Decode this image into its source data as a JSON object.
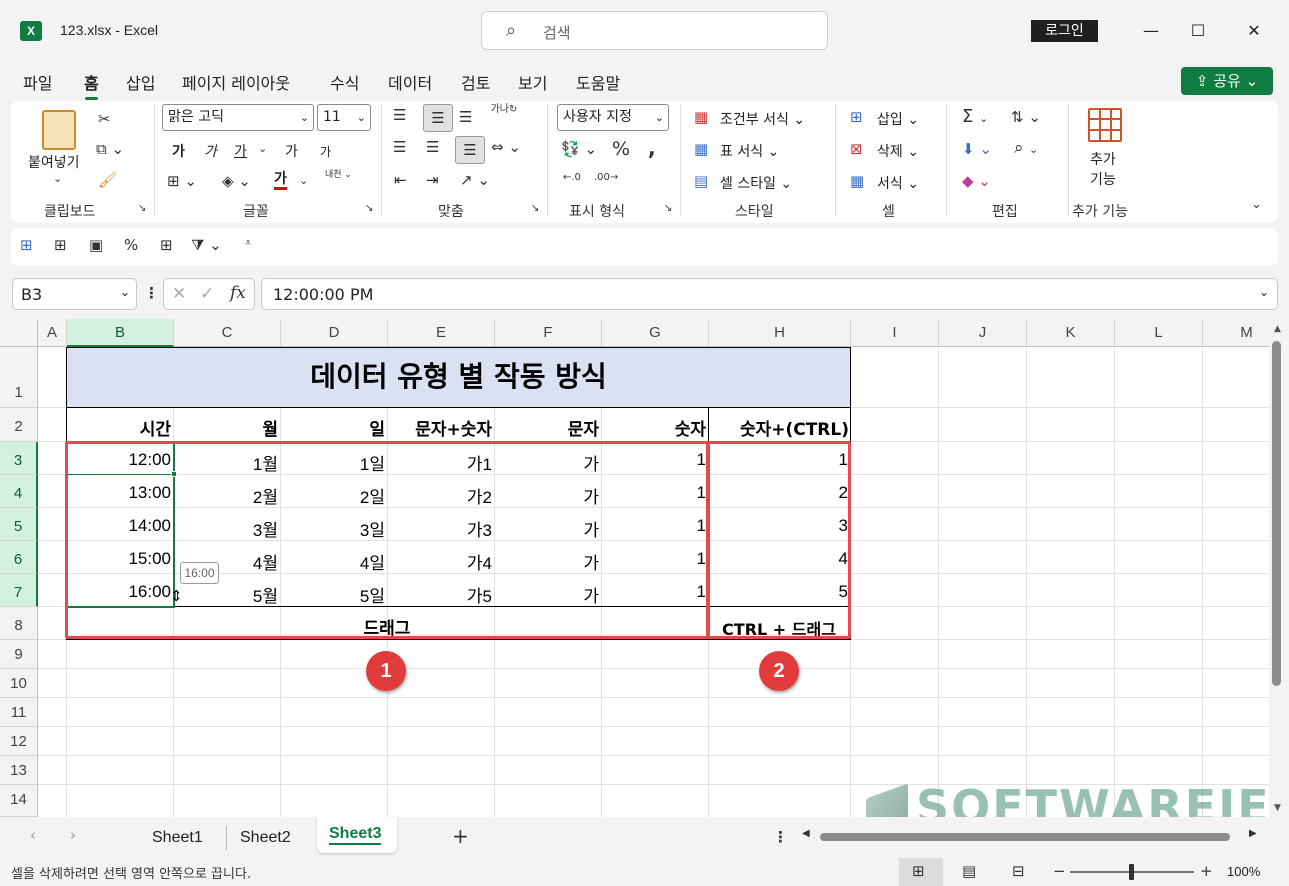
{
  "window": {
    "title": "123.xlsx  -  Excel",
    "logo": "X",
    "login": "로그인",
    "minimize": "—",
    "maximize": "☐",
    "close": "✕"
  },
  "search": {
    "placeholder": "검색"
  },
  "menu_tabs": [
    "파일",
    "홈",
    "삽입",
    "페이지 레이아웃",
    "수식",
    "데이터",
    "검토",
    "보기",
    "도움말"
  ],
  "share": {
    "label": "공유"
  },
  "ribbon": {
    "clipboard": {
      "paste": "붙여넣기",
      "label": "클립보드"
    },
    "font": {
      "name": "맑은 고딕",
      "size": "11",
      "bold": "가",
      "italic": "가",
      "underline": "가",
      "grow": "가",
      "shrink": "가",
      "color": "가",
      "label": "글꼴"
    },
    "align": {
      "label": "맞춤",
      "orient": "가나",
      "wrap": "내천"
    },
    "number": {
      "format": "사용자 지정",
      "label": "표시 형식"
    },
    "styles": {
      "conditional": "조건부 서식",
      "table": "표 서식",
      "cell": "셀 스타일",
      "label": "스타일"
    },
    "cells": {
      "insert": "삽입",
      "delete": "삭제",
      "format": "서식",
      "label": "셀"
    },
    "editing": {
      "label": "편집"
    },
    "addins": {
      "name": "추가 기능",
      "line1": "추가",
      "line2": "기능",
      "label": "추가 기능"
    }
  },
  "formula_bar": {
    "name_box": "B3",
    "value": "12:00:00 PM",
    "fx": "fx"
  },
  "columns": [
    "A",
    "B",
    "C",
    "D",
    "E",
    "F",
    "G",
    "H",
    "I",
    "J",
    "K",
    "L",
    "M"
  ],
  "rows": [
    "1",
    "2",
    "3",
    "4",
    "5",
    "6",
    "7",
    "8",
    "9",
    "10",
    "11",
    "12",
    "13",
    "14"
  ],
  "sheet": {
    "title": "데이터 유형 별 작동 방식",
    "headers": [
      "시간",
      "월",
      "일",
      "문자+숫자",
      "문자",
      "숫자",
      "숫자+(CTRL)"
    ],
    "data": [
      [
        "12:00",
        "1월",
        "1일",
        "가1",
        "가",
        "1",
        "1"
      ],
      [
        "13:00",
        "2월",
        "2일",
        "가2",
        "가",
        "1",
        "2"
      ],
      [
        "14:00",
        "3월",
        "3일",
        "가3",
        "가",
        "1",
        "3"
      ],
      [
        "15:00",
        "4월",
        "4일",
        "가4",
        "가",
        "1",
        "4"
      ],
      [
        "16:00",
        "5월",
        "5일",
        "가5",
        "가",
        "1",
        "5"
      ]
    ],
    "drag_label": "드래그",
    "ctrl_drag_label": "CTRL + 드래그",
    "tooltip": "16:00",
    "badge1": "1",
    "badge2": "2"
  },
  "sheet_tabs": [
    "Sheet1",
    "Sheet2",
    "Sheet3"
  ],
  "active_sheet": "Sheet3",
  "status": {
    "message": "셀을 삭제하려면 선택 영역 안쪽으로 끕니다.",
    "zoom": "100%"
  },
  "watermark": "SOFTWAREIE",
  "colors": {
    "accent": "#107c41",
    "title_fill": "#d9e1f2",
    "red": "#e04c4c"
  }
}
